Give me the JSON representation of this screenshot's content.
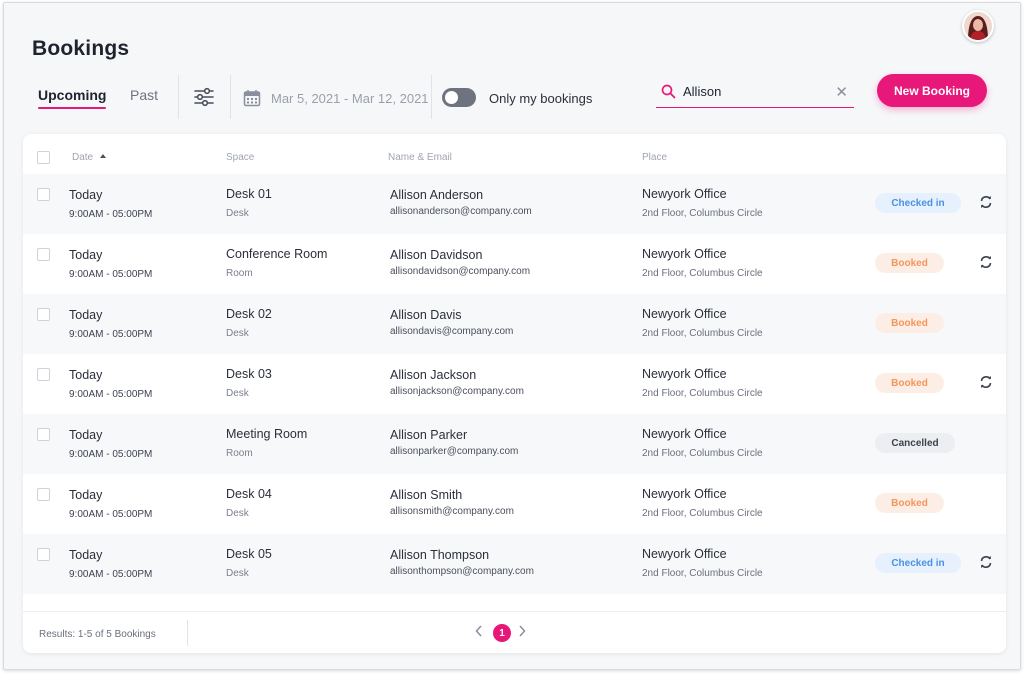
{
  "page": {
    "title": "Bookings"
  },
  "header": {
    "tabs": [
      {
        "label": "Upcoming",
        "active": true
      },
      {
        "label": "Past",
        "active": false
      }
    ],
    "date_range": "Mar 5, 2021 - Mar 12, 2021",
    "toggle": {
      "label": "Only my bookings",
      "on": false
    },
    "search": {
      "value": "Allison",
      "placeholder": ""
    },
    "new_booking_label": "New Booking"
  },
  "table": {
    "columns": {
      "date": "Date",
      "space": "Space",
      "name_email": "Name & Email",
      "place": "Place"
    },
    "rows": [
      {
        "date": "Today",
        "time": "9:00AM - 05:00PM",
        "space": "Desk 01",
        "space_type": "Desk",
        "name": "Allison Anderson",
        "email": "allisonanderson@company.com",
        "place": "Newyork Office",
        "place_detail": "2nd Floor, Columbus Circle",
        "status": "Checked in",
        "recurring": true
      },
      {
        "date": "Today",
        "time": "9:00AM - 05:00PM",
        "space": "Conference Room",
        "space_type": "Room",
        "name": "Allison Davidson",
        "email": "allisondavidson@company.com",
        "place": "Newyork Office",
        "place_detail": "2nd Floor, Columbus Circle",
        "status": "Booked",
        "recurring": true
      },
      {
        "date": "Today",
        "time": "9:00AM - 05:00PM",
        "space": "Desk 02",
        "space_type": "Desk",
        "name": "Allison Davis",
        "email": "allisondavis@company.com",
        "place": "Newyork Office",
        "place_detail": "2nd Floor, Columbus Circle",
        "status": "Booked",
        "recurring": false
      },
      {
        "date": "Today",
        "time": "9:00AM - 05:00PM",
        "space": "Desk 03",
        "space_type": "Desk",
        "name": "Allison Jackson",
        "email": "allisonjackson@company.com",
        "place": "Newyork Office",
        "place_detail": "2nd Floor, Columbus Circle",
        "status": "Booked",
        "recurring": true
      },
      {
        "date": "Today",
        "time": "9:00AM - 05:00PM",
        "space": "Meeting Room",
        "space_type": "Room",
        "name": "Allison Parker",
        "email": "allisonparker@company.com",
        "place": "Newyork Office",
        "place_detail": "2nd Floor, Columbus Circle",
        "status": "Cancelled",
        "recurring": false
      },
      {
        "date": "Today",
        "time": "9:00AM - 05:00PM",
        "space": "Desk 04",
        "space_type": "Desk",
        "name": "Allison Smith",
        "email": "allisonsmith@company.com",
        "place": "Newyork Office",
        "place_detail": "2nd Floor, Columbus Circle",
        "status": "Booked",
        "recurring": false
      },
      {
        "date": "Today",
        "time": "9:00AM - 05:00PM",
        "space": "Desk 05",
        "space_type": "Desk",
        "name": "Allison Thompson",
        "email": "allisonthompson@company.com",
        "place": "Newyork Office",
        "place_detail": "2nd Floor, Columbus Circle",
        "status": "Checked in",
        "recurring": true
      }
    ]
  },
  "footer": {
    "results": "Results: 1-5 of 5 Bookings",
    "current_page": "1"
  },
  "colors": {
    "accent": "#e8177a",
    "checked_in": "#4a90e2",
    "booked": "#f4955c",
    "cancelled": "#3d4250"
  },
  "icons": [
    "sort-up-icon",
    "filter-sliders-icon",
    "calendar-icon",
    "search-icon",
    "clear-icon",
    "refresh-icon",
    "chevron-left-icon",
    "chevron-right-icon"
  ]
}
